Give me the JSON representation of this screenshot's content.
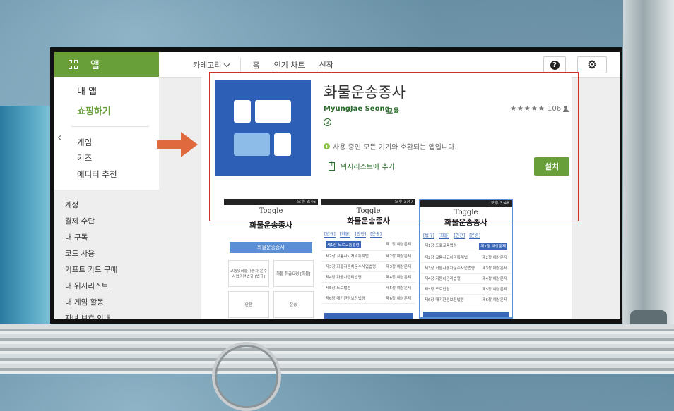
{
  "brand": {
    "label": "앱"
  },
  "nav": {
    "category": "카테고리",
    "home": "홈",
    "top_charts": "인기 차트",
    "new": "신작"
  },
  "sidebar": {
    "my_apps": "내 앱",
    "shop": "쇼핑하기",
    "items": [
      "게임",
      "키즈",
      "에디터 추천"
    ],
    "account": [
      "계정",
      "결제 수단",
      "내 구독",
      "코드 사용",
      "기프트 카드 구매",
      "내 위시리스트",
      "내 게임 활동",
      "자녀 보호 안내"
    ]
  },
  "app": {
    "title": "화물운송종사",
    "developer": "MyungJae Seong",
    "category": "교육",
    "stars": "★★★★★",
    "rating_count": "106",
    "age": "3",
    "compat_text": "사용 중인 모든 기기와 호환되는 앱입니다.",
    "wishlist": "위시리스트에 추가",
    "install": "설치"
  },
  "screens": {
    "status1": "오후 3:46",
    "status2": "오후 3:47",
    "status3": "오후 3:48",
    "logo": "Toggle",
    "title": "화물운송종사",
    "button": "화물운송종사",
    "tabs": [
      "[법규]",
      "[화물]",
      "[안전]",
      "[운송]"
    ],
    "rows": [
      [
        "제1장 도로교통법령",
        "제1장 예상문제"
      ],
      [
        "제2장 교통사고처리특례법",
        "제2장 예상문제"
      ],
      [
        "제3장 화물자동차운수사업법령",
        "제3장 예상문제"
      ],
      [
        "제4장 자동차관리법령",
        "제4장 예상문제"
      ],
      [
        "제5장 도로법령",
        "제5장 예상문제"
      ],
      [
        "제6장 대기환경보전법령",
        "제6장 예상문제"
      ]
    ],
    "boxes": [
      "교통및화물자동차 운수사업관련법규 [법규]",
      "화물 취급요령 [화물]",
      "안전",
      "운송"
    ]
  },
  "colors": {
    "brand_green": "#689f38",
    "highlight_red": "#d32f2f",
    "icon_blue": "#2d5fb6",
    "arrow_orange": "#e06a3e"
  }
}
